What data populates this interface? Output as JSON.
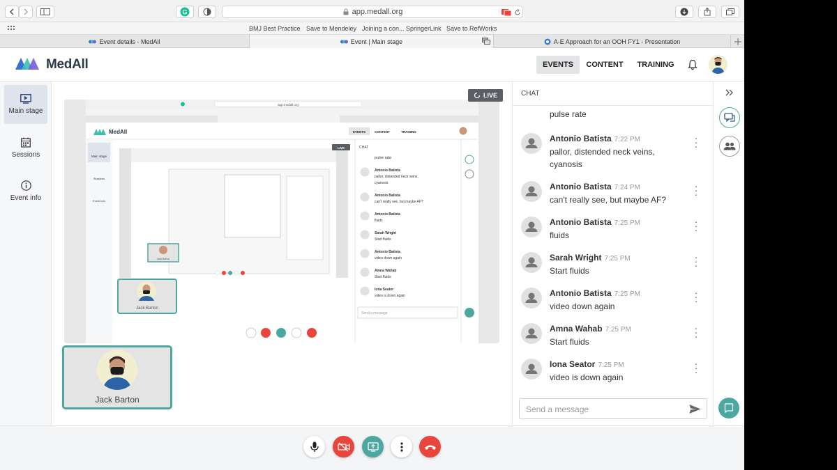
{
  "browser": {
    "url": "app.medall.org",
    "favorites": [
      "BMJ Best Practice",
      "Save to Mendeley",
      "Joining a con... SpringerLink",
      "Save to RefWorks"
    ],
    "tabs": [
      "Event details - MedAll",
      "Event | Main stage",
      "A-E Approach for an OOH FY1 - Presentation"
    ]
  },
  "app": {
    "logo": "MedAll",
    "nav": [
      "EVENTS",
      "CONTENT",
      "TRAINING"
    ]
  },
  "sidebar": {
    "items": [
      {
        "label": "Main stage"
      },
      {
        "label": "Sessions"
      },
      {
        "label": "Event info"
      }
    ]
  },
  "stage": {
    "live_label": "LIVE",
    "participant_name": "Jack Barton"
  },
  "chat": {
    "title": "CHAT",
    "partial_text": "pulse rate",
    "messages": [
      {
        "name": "Antonio Batista",
        "time": "7:22 PM",
        "text": "pallor, distended neck veins, cyanosis"
      },
      {
        "name": "Antonio Batista",
        "time": "7:24 PM",
        "text": "can't really see, but maybe AF?"
      },
      {
        "name": "Antonio Batista",
        "time": "7:25 PM",
        "text": "fluids"
      },
      {
        "name": "Sarah Wright",
        "time": "7:25 PM",
        "text": "Start fluids"
      },
      {
        "name": "Antonio Batista",
        "time": "7:25 PM",
        "text": "video down again"
      },
      {
        "name": "Amna Wahab",
        "time": "7:25 PM",
        "text": "Start fluids"
      },
      {
        "name": "Iona Seator",
        "time": "7:25 PM",
        "text": "video is down again"
      }
    ],
    "input_placeholder": "Send a message"
  },
  "nested": {
    "url": "app.medall.org",
    "logo": "MedAll",
    "nav": [
      "EVENTS",
      "CONTENT",
      "TRAINING"
    ],
    "side": [
      "Main stage",
      "Sessions",
      "Event info"
    ],
    "chat_title": "CHAT",
    "partial": "pulse rate",
    "participant": "Jack Barton",
    "placeholder": "Send a message",
    "live": "LIVE"
  },
  "colors": {
    "accent": "#4ca7a0",
    "mic": "#ffffff",
    "camera_off": "#e8453c",
    "share": "#4ca7a0",
    "hangup": "#e8453c"
  }
}
